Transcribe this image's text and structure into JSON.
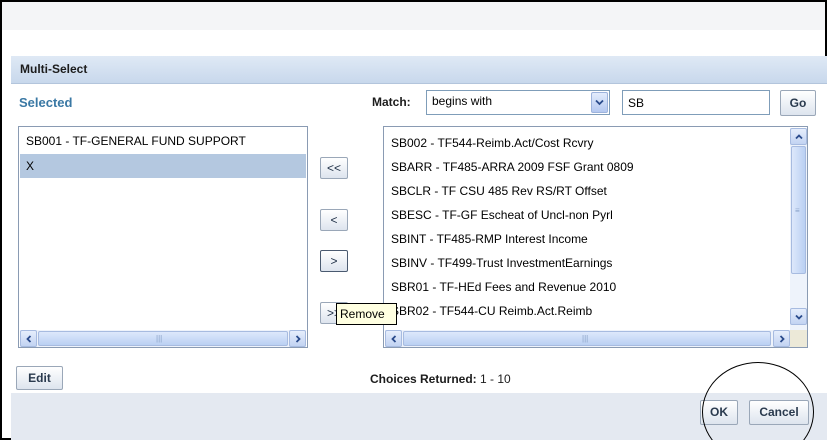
{
  "dialog": {
    "title": "Multi-Select",
    "selected_label": "Selected",
    "match_label": "Match:",
    "match_mode": "begins with",
    "search_value": "SB",
    "go_label": "Go",
    "edit_label": "Edit",
    "choices_label": "Choices Returned:",
    "choices_value": "1 - 10",
    "ok_label": "OK",
    "cancel_label": "Cancel"
  },
  "selected_items": [
    "SB001 - TF-GENERAL FUND SUPPORT",
    "X"
  ],
  "available_items": [
    "SB002 - TF544-Reimb.Act/Cost Rcvry",
    "SBARR - TF485-ARRA 2009 FSF Grant 0809",
    "SBCLR - TF CSU 485 Rev RS/RT Offset",
    "SBESC - TF-GF Escheat of Uncl-non Pyrl",
    "SBINT - TF485-RMP Interest Income",
    "SBINV - TF499-Trust InvestmentEarnings",
    "SBR01 - TF-HEd Fees and Revenue 2010",
    "SBR02 - TF544-CU Reimb.Act.Reimb"
  ],
  "move_buttons": {
    "remove_all": "<<",
    "remove": "<",
    "add": ">",
    "add_all": ">>"
  },
  "tooltip": "Remove",
  "icons": {
    "dropdown": "chevron-down-icon",
    "scroll_left": "arrow-left-icon",
    "scroll_right": "arrow-right-icon",
    "scroll_up": "arrow-up-icon",
    "scroll_down": "arrow-down-icon"
  },
  "colors": {
    "accent": "#3a78a4",
    "selection": "#b4c8e0",
    "title_bar": "#c8d8ec",
    "footer": "#e4e9f1",
    "tooltip": "#ffffe1"
  }
}
